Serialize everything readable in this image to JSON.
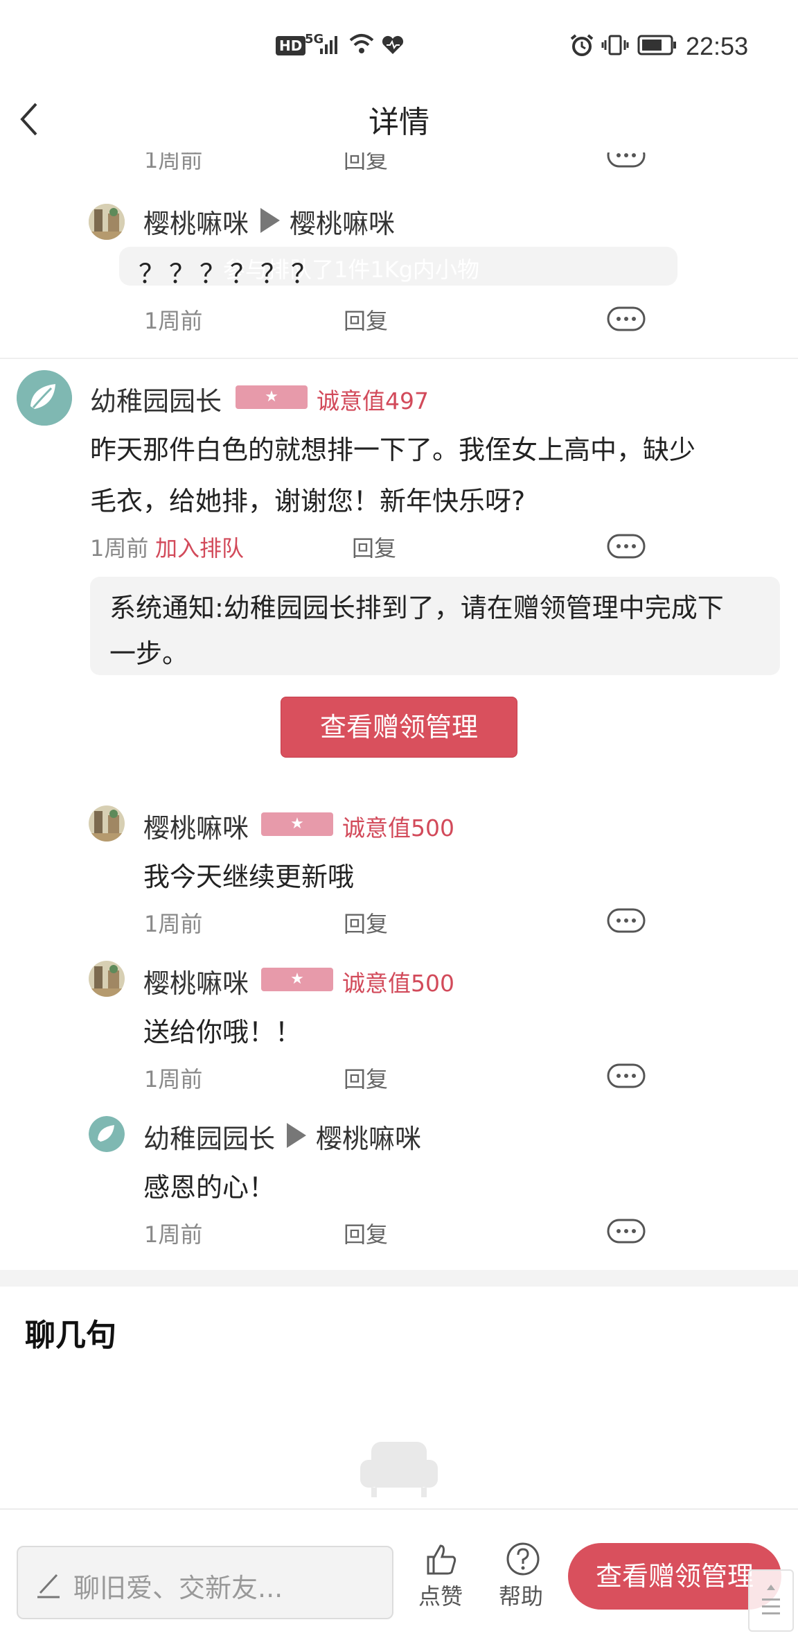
{
  "status_bar": {
    "hd": "HD",
    "network": "5G",
    "time": "22:53"
  },
  "header": {
    "title": "详情"
  },
  "partial_top": {
    "time": "1周前",
    "reply": "回复"
  },
  "replies_top": [
    {
      "from": "樱桃嘛咪",
      "to": "樱桃嘛咪",
      "text": "？？？？？？",
      "overlay_text": "参与排队了1件1Kg内小物",
      "time": "1周前",
      "reply": "回复"
    }
  ],
  "main_comment": {
    "name": "幼稚园园长",
    "badge": "★",
    "sincere": "诚意值497",
    "text_line1": "昨天那件白色的就想排一下了。我侄女上高中，缺少",
    "text_line2": "毛衣，给她排，谢谢您！新年快乐呀?",
    "time": "1周前",
    "join_queue": "加入排队",
    "reply": "回复"
  },
  "system_notice": {
    "line1": "系统通知:幼稚园园长排到了，请在赠领管理中完成下",
    "line2": "一步。",
    "button": "查看赠领管理"
  },
  "replies": [
    {
      "name": "樱桃嘛咪",
      "badge": "★",
      "sincere": "诚意值500",
      "text": "我今天继续更新哦",
      "time": "1周前",
      "reply": "回复"
    },
    {
      "name": "樱桃嘛咪",
      "badge": "★",
      "sincere": "诚意值500",
      "text": "送给你哦！！",
      "time": "1周前",
      "reply": "回复"
    },
    {
      "from": "幼稚园园长",
      "to": "樱桃嘛咪",
      "text": "感恩的心！",
      "time": "1周前",
      "reply": "回复"
    }
  ],
  "chat_section": {
    "title": "聊几句"
  },
  "bottom_bar": {
    "placeholder": "聊旧爱、交新友...",
    "like_label": "点赞",
    "help_label": "帮助",
    "manage_button": "查看赠领管理"
  },
  "colors": {
    "accent_red": "#d9505d",
    "badge_pink": "#e79aaa",
    "sincere_text": "#d24a5a",
    "avatar_teal": "#7fb8b2"
  },
  "icons": [
    "back-arrow-icon",
    "more-options-icon",
    "like-thumb-icon",
    "help-question-icon",
    "pencil-icon",
    "sofa-empty-icon",
    "scroll-top-icon",
    "alarm-icon",
    "vibrate-icon",
    "battery-icon",
    "wifi-icon",
    "signal-icon",
    "heart-icon"
  ]
}
